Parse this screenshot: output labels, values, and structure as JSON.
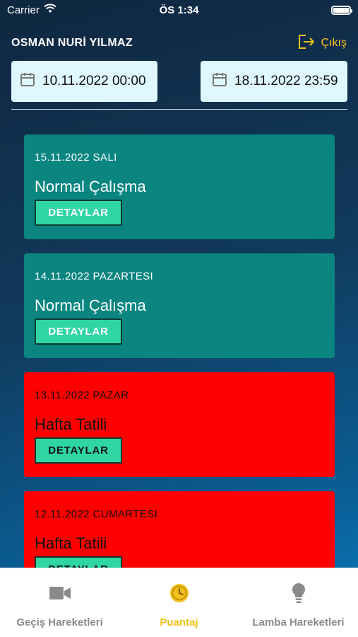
{
  "status_bar": {
    "carrier": "Carrier",
    "time": "ÖS 1:34"
  },
  "header": {
    "user_name": "OSMAN NURİ YILMAZ",
    "logout_label": "Çıkış"
  },
  "date_range": {
    "from": "10.11.2022 00:00",
    "to": "18.11.2022 23:59"
  },
  "records": [
    {
      "date": "15.11.2022 SALI",
      "status": "Normal Çalışma",
      "button": "DETAYLAR",
      "kind": "work"
    },
    {
      "date": "14.11.2022 PAZARTESI",
      "status": "Normal Çalışma",
      "button": "DETAYLAR",
      "kind": "work"
    },
    {
      "date": "13.11.2022 PAZAR",
      "status": "Hafta Tatili",
      "button": "DETAYLAR",
      "kind": "holiday"
    },
    {
      "date": "12.11.2022 CUMARTESI",
      "status": "Hafta Tatili",
      "button": "DETAYLAR",
      "kind": "holiday"
    }
  ],
  "tabs": [
    {
      "label": "Geçiş Hareketleri",
      "icon": "video-camera-icon",
      "active": false
    },
    {
      "label": "Puantaj",
      "icon": "clock-icon",
      "active": true
    },
    {
      "label": "Lamba Hareketleri",
      "icon": "lightbulb-icon",
      "active": false
    }
  ],
  "colors": {
    "accent": "#f2c01a",
    "work_card": "#0a8580",
    "holiday_card": "#ff0000",
    "detail_button": "#2fd6a3",
    "date_field": "#dff7ff"
  }
}
